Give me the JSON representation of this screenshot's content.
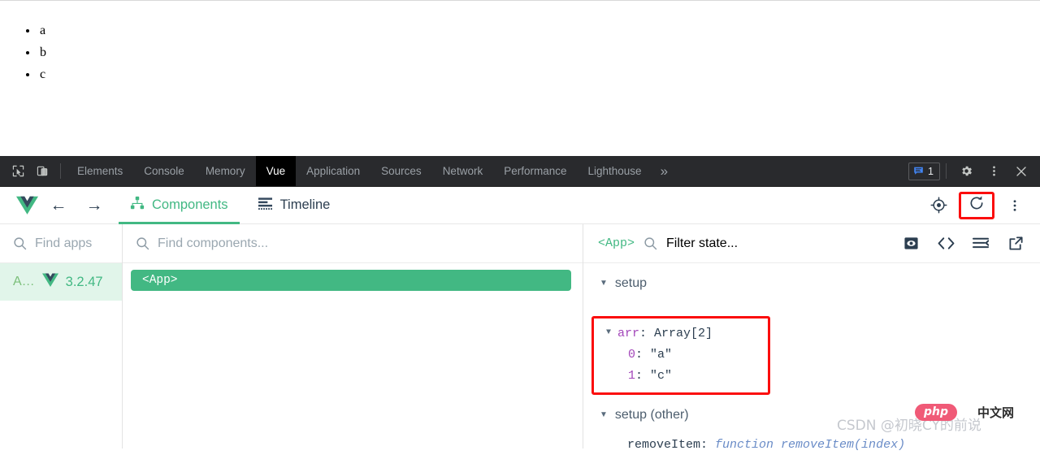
{
  "page": {
    "list_items": [
      "a",
      "b",
      "c"
    ]
  },
  "devtools_bar": {
    "icons": {
      "inspect": "inspect-element-icon",
      "device": "device-toolbar-icon",
      "settings": "gear-icon",
      "kebab": "more-options-icon",
      "close": "close-icon"
    },
    "tabs": [
      {
        "label": "Elements",
        "active": false
      },
      {
        "label": "Console",
        "active": false
      },
      {
        "label": "Memory",
        "active": false
      },
      {
        "label": "Vue",
        "active": true
      },
      {
        "label": "Application",
        "active": false
      },
      {
        "label": "Sources",
        "active": false
      },
      {
        "label": "Network",
        "active": false
      },
      {
        "label": "Performance",
        "active": false
      },
      {
        "label": "Lighthouse",
        "active": false
      }
    ],
    "overflow_label": "»",
    "message_count": "1",
    "colors": {
      "bar_background": "#292a2d",
      "active_tab_background": "#000000",
      "tab_text": "#9aa0a6",
      "badge_blue": "#4285f4"
    }
  },
  "vue_header": {
    "back_arrow": "←",
    "forward_arrow": "→",
    "tabs": [
      {
        "label": "Components",
        "icon": "component-tree-icon",
        "active": true
      },
      {
        "label": "Timeline",
        "icon": "timeline-icon",
        "active": false
      }
    ],
    "buttons": {
      "select_component": "crosshair-target-icon",
      "refresh": "refresh-icon",
      "more": "more-options-icon"
    },
    "accent_color": "#42b883"
  },
  "apps_pane": {
    "search_placeholder": "Find apps",
    "search_icon": "search-icon",
    "items": [
      {
        "name": "A…",
        "version": "3.2.47",
        "icon": "vue-logo-icon",
        "selected": true
      }
    ]
  },
  "components_pane": {
    "search_placeholder": "Find components...",
    "search_icon": "search-icon",
    "tree": [
      {
        "label": "<App>",
        "selected": true
      }
    ]
  },
  "state_pane": {
    "component_name": "<App>",
    "filter_placeholder": "Filter state...",
    "buttons": {
      "inspect_dom": "eye-icon",
      "open_in_editor": "code-brackets-icon",
      "collapse_all": "collapse-list-icon",
      "detach_window": "external-link-icon"
    },
    "groups": [
      {
        "title": "setup",
        "expanded": true,
        "highlighted": true,
        "rows": [
          {
            "key": "arr",
            "separator": ": ",
            "value": "Array[2]",
            "key_class": "k-key",
            "value_class": "k-plain",
            "expandable": true,
            "indent": 0
          },
          {
            "key": "0",
            "separator": ": ",
            "value": "\"a\"",
            "key_class": "k-key",
            "value_class": "k-str",
            "expandable": false,
            "indent": 1
          },
          {
            "key": "1",
            "separator": ": ",
            "value": "\"c\"",
            "key_class": "k-key",
            "value_class": "k-str",
            "expandable": false,
            "indent": 1
          }
        ]
      },
      {
        "title": "setup (other)",
        "expanded": true,
        "highlighted": false,
        "rows": [
          {
            "key": "removeItem",
            "separator": ": ",
            "value": "function removeItem(index)",
            "key_class": "k-plain",
            "value_class": "k-fn",
            "expandable": false,
            "indent": 0
          }
        ]
      }
    ],
    "highlight_color": "#fb0d0d"
  },
  "watermark": {
    "text": "CSDN @初晓CY的前说",
    "logo_text": "php",
    "logo_suffix": "中文网"
  }
}
